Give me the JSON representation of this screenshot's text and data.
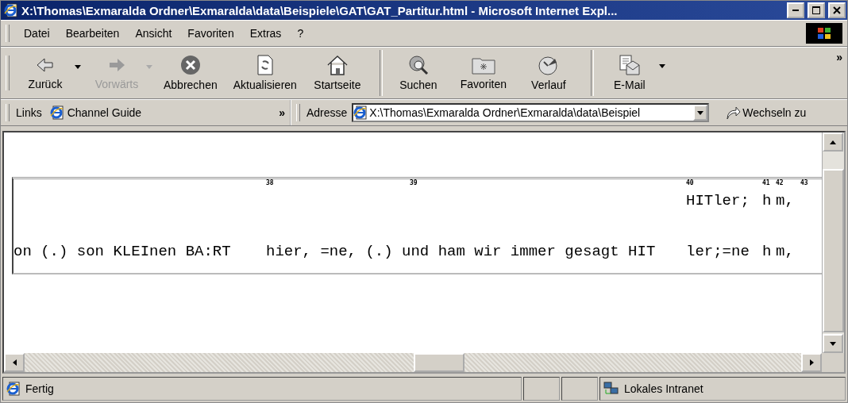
{
  "window": {
    "title": "X:\\Thomas\\Exmaralda Ordner\\Exmaralda\\data\\Beispiele\\GAT\\GAT_Partitur.html - Microsoft Internet Expl..."
  },
  "menu": [
    {
      "label": "Datei"
    },
    {
      "label": "Bearbeiten"
    },
    {
      "label": "Ansicht"
    },
    {
      "label": "Favoriten"
    },
    {
      "label": "Extras"
    },
    {
      "label": "?"
    }
  ],
  "toolbar": {
    "groups": [
      [
        {
          "kind": "back",
          "label": "Zurück",
          "disabled": false,
          "dropdown": true
        },
        {
          "kind": "forward",
          "label": "Vorwärts",
          "disabled": true,
          "dropdown": true
        },
        {
          "kind": "stop",
          "label": "Abbrechen",
          "disabled": false,
          "dropdown": false
        },
        {
          "kind": "refresh",
          "label": "Aktualisieren",
          "disabled": false,
          "dropdown": false
        },
        {
          "kind": "home",
          "label": "Startseite",
          "disabled": false,
          "dropdown": false
        }
      ],
      [
        {
          "kind": "search",
          "label": "Suchen",
          "disabled": false,
          "dropdown": false
        },
        {
          "kind": "favorites",
          "label": "Favoriten",
          "disabled": false,
          "dropdown": false
        },
        {
          "kind": "history",
          "label": "Verlauf",
          "disabled": false,
          "dropdown": false
        }
      ],
      [
        {
          "kind": "mail",
          "label": "E-Mail",
          "disabled": false,
          "dropdown": true
        }
      ]
    ],
    "more": "»"
  },
  "links": {
    "label": "Links",
    "items": [
      "Channel Guide"
    ],
    "more": "»"
  },
  "address": {
    "label": "Adresse",
    "value": "X:\\Thomas\\Exmaralda Ordner\\Exmaralda\\data\\Beispiel",
    "go": "Wechseln zu"
  },
  "partitur": {
    "columns": [
      {
        "bottom": "on (.) son KLEInen BA:RT"
      },
      {
        "tick": "38",
        "bottom": "hier, =ne, (.) und ham wir immer gesagt HIT"
      },
      {
        "tick": "39"
      },
      {
        "tick": "40",
        "top": "HITler;",
        "bottom": "ler;=ne"
      },
      {
        "tick": "41",
        "top": "h",
        "bottom": "h"
      },
      {
        "tick": "42",
        "top": "m,",
        "bottom": "m,"
      },
      {
        "tick": "43"
      }
    ]
  },
  "status_bar": {
    "text": "Fertig",
    "zone": "Lokales Intranet"
  }
}
